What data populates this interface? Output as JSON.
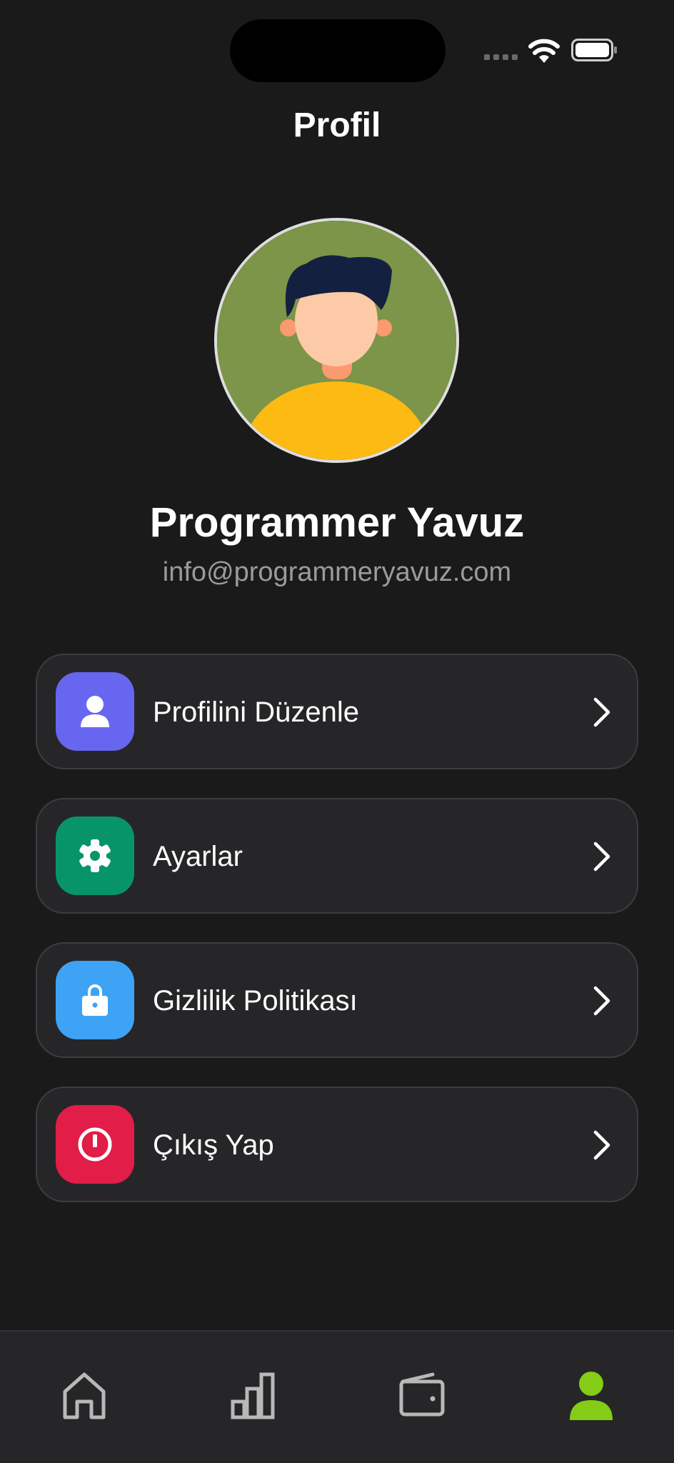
{
  "header": {
    "title": "Profil"
  },
  "profile": {
    "name": "Programmer Yavuz",
    "email": "info@programmeryavuz.com"
  },
  "menu": [
    {
      "label": "Profilini Düzenle",
      "icon": "person-icon",
      "color": "#6766f1"
    },
    {
      "label": "Ayarlar",
      "icon": "gear-icon",
      "color": "#079568"
    },
    {
      "label": "Gizlilik Politikası",
      "icon": "lock-icon",
      "color": "#3ea3f5"
    },
    {
      "label": "Çıkış Yap",
      "icon": "power-icon",
      "color": "#e11d48"
    }
  ],
  "tabs": [
    {
      "name": "home",
      "icon": "home-icon",
      "active": false
    },
    {
      "name": "stats",
      "icon": "bar-chart-icon",
      "active": false
    },
    {
      "name": "wallet",
      "icon": "wallet-icon",
      "active": false
    },
    {
      "name": "profile",
      "icon": "person-icon",
      "active": true
    }
  ],
  "colors": {
    "background": "#1a1a1b",
    "card": "#262628",
    "accent": "#84cc16",
    "muted": "#9b9b9b"
  }
}
